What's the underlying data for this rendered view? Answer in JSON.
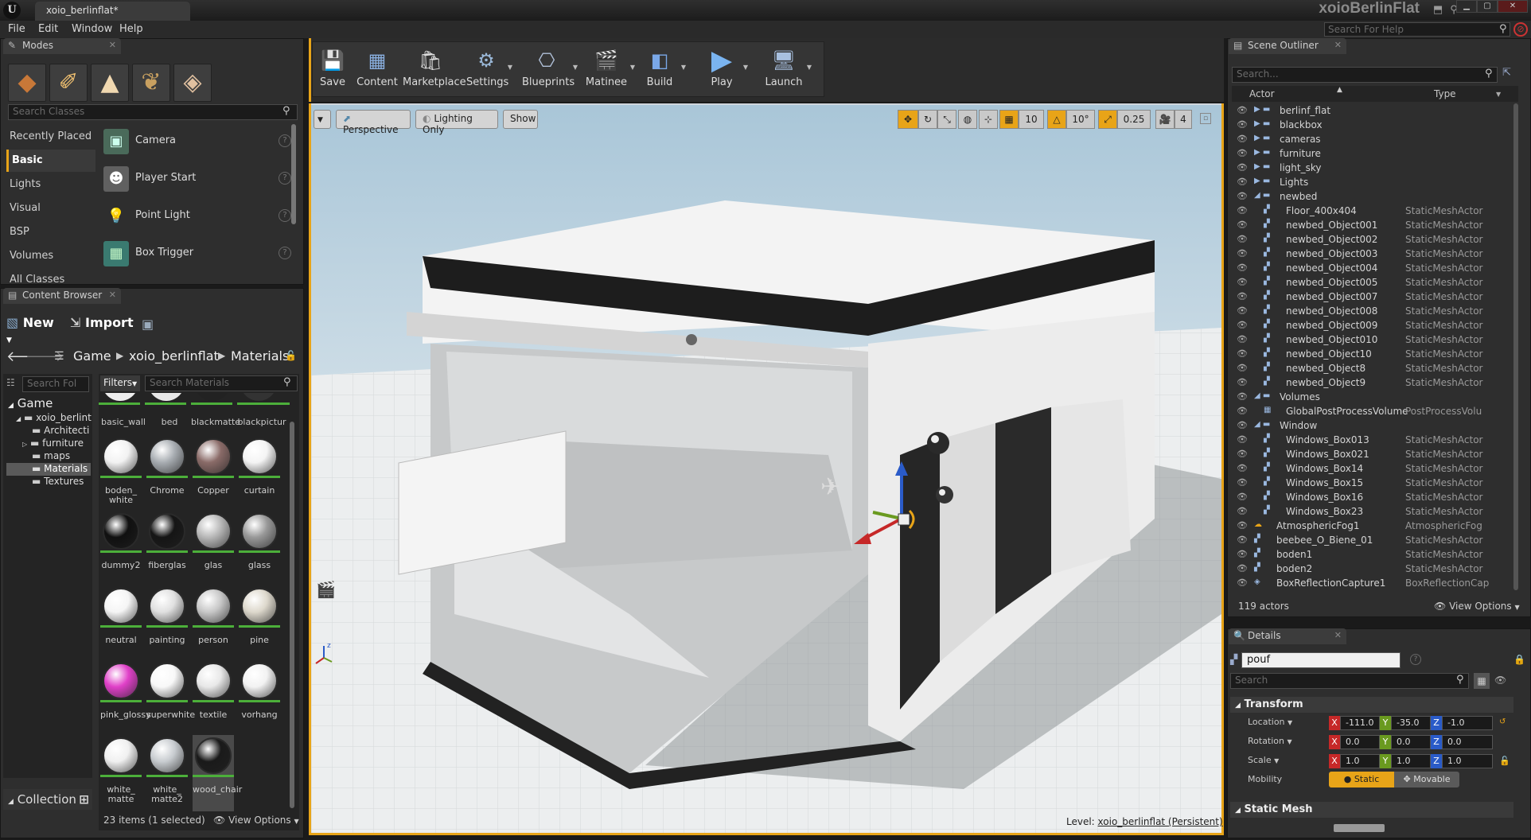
{
  "titlebar": {
    "doc_tab": "xoio_berlinflat*",
    "app_name": "xoioBerlinFlat"
  },
  "menu": [
    "File",
    "Edit",
    "Window",
    "Help"
  ],
  "help_search_placeholder": "Search For Help",
  "modes": {
    "tab": "Modes",
    "search_placeholder": "Search Classes",
    "categories": [
      "Recently Placed",
      "Basic",
      "Lights",
      "Visual",
      "BSP",
      "Volumes",
      "All Classes"
    ],
    "selected_category": "Basic",
    "items": [
      "Camera",
      "Player Start",
      "Point Light",
      "Box Trigger"
    ]
  },
  "content_browser": {
    "tab": "Content Browser",
    "new_label": "New",
    "import_label": "Import",
    "path": [
      "Game",
      "xoio_berlinflat",
      "Materials"
    ],
    "folder_search_placeholder": "Search Fol",
    "filters_label": "Filters",
    "search_placeholder": "Search Materials",
    "tree": [
      "Game",
      "xoio_berlint",
      "Architecti",
      "furniture",
      "maps",
      "Materials",
      "Textures"
    ],
    "materials_top": [
      "basic_wall",
      "bed",
      "blackmatte",
      "blackpictur"
    ],
    "materials": [
      {
        "name": "boden_\nwhite",
        "color": "#f2f2f2"
      },
      {
        "name": "Chrome",
        "color": "#a8adb2"
      },
      {
        "name": "Copper",
        "color": "#8a6b68"
      },
      {
        "name": "curtain",
        "color": "#f4f4f4"
      },
      {
        "name": "dummy2",
        "color": "#101010"
      },
      {
        "name": "fiberglas",
        "color": "#151515"
      },
      {
        "name": "glas",
        "color": "#b8b8b8"
      },
      {
        "name": "glass",
        "color": "#999"
      },
      {
        "name": "neutral",
        "color": "#f5f5f5"
      },
      {
        "name": "painting",
        "color": "#e0e0e0"
      },
      {
        "name": "person",
        "color": "#c8c8c8"
      },
      {
        "name": "pine",
        "color": "#ddd8cc"
      },
      {
        "name": "pink_glossy",
        "color": "#e040c8"
      },
      {
        "name": "superwhite",
        "color": "#f8f8f8"
      },
      {
        "name": "textile",
        "color": "#e8e8e8"
      },
      {
        "name": "vorhang",
        "color": "#f2f2f2"
      },
      {
        "name": "white_\nmatte",
        "color": "#f0f0f0"
      },
      {
        "name": "white_\nmatte2",
        "color": "#c8ccd0"
      },
      {
        "name": "wood_chair",
        "color": "#1a1a1a"
      }
    ],
    "status": "23 items (1 selected)",
    "view_options": "View Options",
    "collections_label": "Collection"
  },
  "toolbar": [
    "Save",
    "Content",
    "Marketplace",
    "Settings",
    "Blueprints",
    "Matinee",
    "Build",
    "Play",
    "Launch"
  ],
  "viewport": {
    "perspective": "Perspective",
    "lighting": "Lighting Only",
    "show": "Show",
    "grid_snap": "10",
    "rot_snap": "10°",
    "scale_snap": "0.25",
    "cam_speed": "4",
    "level_label": "Level:",
    "level_name": "xoio_berlinflat (Persistent)"
  },
  "outliner": {
    "tab": "Scene Outliner",
    "search_placeholder": "Search...",
    "col_actor": "Actor",
    "col_type": "Type",
    "rows": [
      {
        "name": "berlinf_flat",
        "type": "",
        "depth": 0,
        "kind": "folder"
      },
      {
        "name": "blackbox",
        "type": "",
        "depth": 0,
        "kind": "folder"
      },
      {
        "name": "cameras",
        "type": "",
        "depth": 0,
        "kind": "folder"
      },
      {
        "name": "furniture",
        "type": "",
        "depth": 0,
        "kind": "folder"
      },
      {
        "name": "light_sky",
        "type": "",
        "depth": 0,
        "kind": "folder"
      },
      {
        "name": "Lights",
        "type": "",
        "depth": 0,
        "kind": "folder"
      },
      {
        "name": "newbed",
        "type": "",
        "depth": 0,
        "kind": "folder-open"
      },
      {
        "name": "Floor_400x404",
        "type": "StaticMeshActor",
        "depth": 1,
        "kind": "mesh"
      },
      {
        "name": "newbed_Object001",
        "type": "StaticMeshActor",
        "depth": 1,
        "kind": "mesh"
      },
      {
        "name": "newbed_Object002",
        "type": "StaticMeshActor",
        "depth": 1,
        "kind": "mesh"
      },
      {
        "name": "newbed_Object003",
        "type": "StaticMeshActor",
        "depth": 1,
        "kind": "mesh"
      },
      {
        "name": "newbed_Object004",
        "type": "StaticMeshActor",
        "depth": 1,
        "kind": "mesh"
      },
      {
        "name": "newbed_Object005",
        "type": "StaticMeshActor",
        "depth": 1,
        "kind": "mesh"
      },
      {
        "name": "newbed_Object007",
        "type": "StaticMeshActor",
        "depth": 1,
        "kind": "mesh"
      },
      {
        "name": "newbed_Object008",
        "type": "StaticMeshActor",
        "depth": 1,
        "kind": "mesh"
      },
      {
        "name": "newbed_Object009",
        "type": "StaticMeshActor",
        "depth": 1,
        "kind": "mesh"
      },
      {
        "name": "newbed_Object010",
        "type": "StaticMeshActor",
        "depth": 1,
        "kind": "mesh"
      },
      {
        "name": "newbed_Object10",
        "type": "StaticMeshActor",
        "depth": 1,
        "kind": "mesh"
      },
      {
        "name": "newbed_Object8",
        "type": "StaticMeshActor",
        "depth": 1,
        "kind": "mesh"
      },
      {
        "name": "newbed_Object9",
        "type": "StaticMeshActor",
        "depth": 1,
        "kind": "mesh"
      },
      {
        "name": "Volumes",
        "type": "",
        "depth": 0,
        "kind": "folder-open"
      },
      {
        "name": "GlobalPostProcessVolume",
        "type": "PostProcessVolu",
        "depth": 1,
        "kind": "volume"
      },
      {
        "name": "Window",
        "type": "",
        "depth": 0,
        "kind": "folder-open"
      },
      {
        "name": "Windows_Box013",
        "type": "StaticMeshActor",
        "depth": 1,
        "kind": "mesh"
      },
      {
        "name": "Windows_Box021",
        "type": "StaticMeshActor",
        "depth": 1,
        "kind": "mesh"
      },
      {
        "name": "Windows_Box14",
        "type": "StaticMeshActor",
        "depth": 1,
        "kind": "mesh"
      },
      {
        "name": "Windows_Box15",
        "type": "StaticMeshActor",
        "depth": 1,
        "kind": "mesh"
      },
      {
        "name": "Windows_Box16",
        "type": "StaticMeshActor",
        "depth": 1,
        "kind": "mesh"
      },
      {
        "name": "Windows_Box23",
        "type": "StaticMeshActor",
        "depth": 1,
        "kind": "mesh"
      },
      {
        "name": "AtmosphericFog1",
        "type": "AtmosphericFog",
        "depth": 0,
        "kind": "fog"
      },
      {
        "name": "beebee_O_Biene_01",
        "type": "StaticMeshActor",
        "depth": 0,
        "kind": "mesh"
      },
      {
        "name": "boden1",
        "type": "StaticMeshActor",
        "depth": 0,
        "kind": "mesh"
      },
      {
        "name": "boden2",
        "type": "StaticMeshActor",
        "depth": 0,
        "kind": "mesh"
      },
      {
        "name": "BoxReflectionCapture1",
        "type": "BoxReflectionCap",
        "depth": 0,
        "kind": "capture"
      }
    ],
    "count": "119 actors",
    "view_options": "View Options"
  },
  "details": {
    "tab": "Details",
    "name_value": "pouf",
    "search_placeholder": "Search",
    "transform_label": "Transform",
    "location_label": "Location",
    "rotation_label": "Rotation",
    "scale_label": "Scale",
    "mobility_label": "Mobility",
    "location": [
      "-111.0",
      "-35.0",
      "-1.0"
    ],
    "rotation": [
      "0.0",
      "0.0",
      "0.0"
    ],
    "scale": [
      "1.0",
      "1.0",
      "1.0"
    ],
    "mobility_static": "Static",
    "mobility_movable": "Movable",
    "static_mesh_label": "Static Mesh"
  },
  "colors": {
    "accent_orange": "#e8a418",
    "x_axis": "#c62828",
    "y_axis": "#6a9a1f",
    "z_axis": "#2a5bc8"
  }
}
